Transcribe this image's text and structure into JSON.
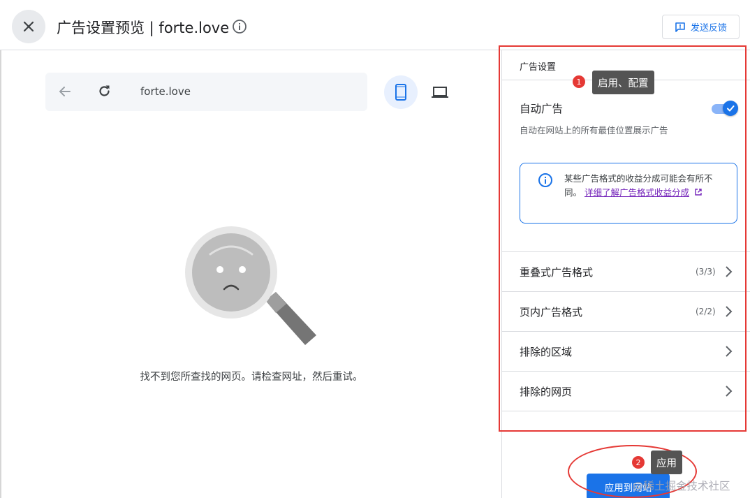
{
  "header": {
    "close_icon": "close-icon",
    "title": "广告设置预览 | forte.love",
    "info_icon": "info-icon",
    "feedback_label": "发送反馈",
    "feedback_icon": "feedback-icon"
  },
  "preview": {
    "back_icon": "arrow-back-icon",
    "reload_icon": "refresh-icon",
    "url": "forte.love",
    "device_mobile_icon": "smartphone-icon",
    "device_desktop_icon": "laptop-icon",
    "not_found_message": "找不到您所查找的网页。请检查网址，然后重试。"
  },
  "panel": {
    "heading": "广告设置",
    "auto_ads": {
      "label": "自动广告",
      "enabled": true,
      "description": "自动在网站上的所有最佳位置展示广告"
    },
    "info_box": {
      "text": "某些广告格式的收益分成可能会有所不同。",
      "link": "详细了解广告格式收益分成",
      "link_icon": "open-in-new-icon"
    },
    "items": [
      {
        "label": "重叠式广告格式",
        "count": "(3/3)"
      },
      {
        "label": "页内广告格式",
        "count": "(2/2)"
      },
      {
        "label": "排除的区域",
        "count": ""
      },
      {
        "label": "排除的网页",
        "count": ""
      }
    ],
    "apply_button": "应用到网站"
  },
  "annotations": {
    "badge1": "1",
    "tip1": "启用、配置",
    "badge2": "2",
    "tip2": "应用",
    "color": "#e53935"
  },
  "watermark": "@稀土掘金技术社区",
  "colors": {
    "accent": "#1a73e8",
    "link": "#7627bb",
    "divider": "#dadce0"
  }
}
